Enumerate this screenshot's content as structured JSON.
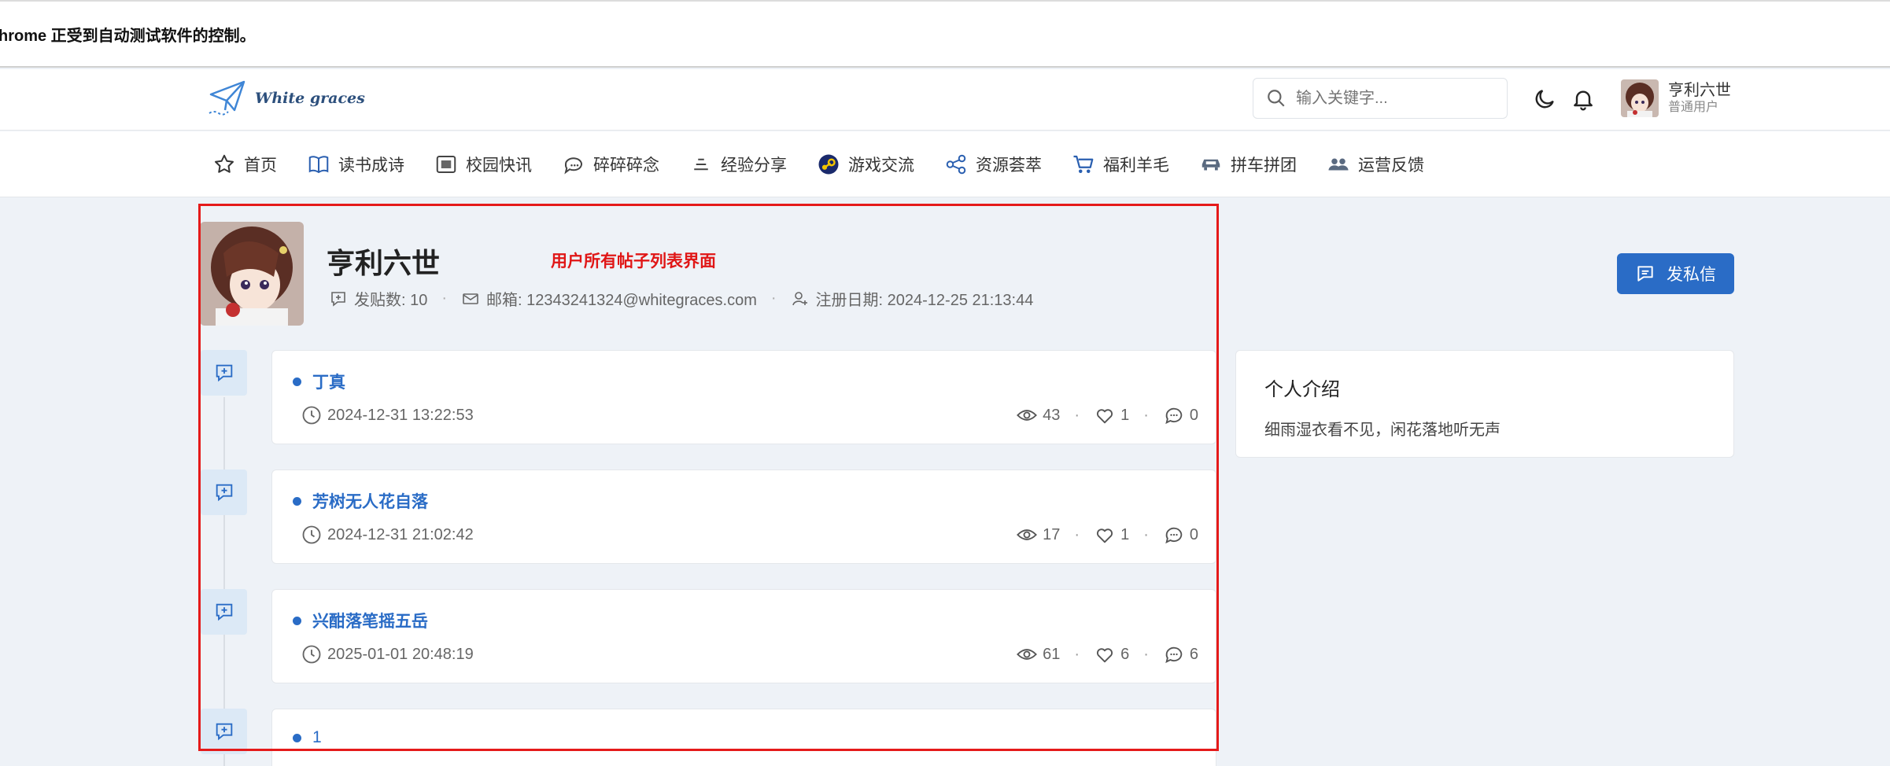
{
  "browser": {
    "infobar_text": "hrome 正受到自动测试软件的控制。"
  },
  "header": {
    "brand": "White graces",
    "search_placeholder": "输入关键字...",
    "icons": [
      "search-icon",
      "moon-icon",
      "bell-icon"
    ],
    "user": {
      "name": "亨利六世",
      "role": "普通用户"
    }
  },
  "nav": {
    "items": [
      {
        "label": "首页",
        "icon": "star-icon"
      },
      {
        "label": "读书成诗",
        "icon": "book-icon"
      },
      {
        "label": "校园快讯",
        "icon": "news-icon"
      },
      {
        "label": "碎碎碎念",
        "icon": "chat-bubble-icon"
      },
      {
        "label": "经验分享",
        "icon": "stack-icon"
      },
      {
        "label": "游戏交流",
        "icon": "steam-icon"
      },
      {
        "label": "资源荟萃",
        "icon": "share-nodes-icon"
      },
      {
        "label": "福利羊毛",
        "icon": "cart-icon"
      },
      {
        "label": "拼车拼团",
        "icon": "car-icon"
      },
      {
        "label": "运营反馈",
        "icon": "users-icon"
      }
    ]
  },
  "profile": {
    "name": "亨利六世",
    "annotation": "用户所有帖子列表界面",
    "post_count": "发贴数: 10",
    "email": "邮箱: 12343241324@whitegraces.com",
    "register_date": "注册日期: 2024-12-25 21:13:44",
    "dm_button": "发私信"
  },
  "posts": [
    {
      "title": "丁真",
      "date": "2024-12-31 13:22:53",
      "views": "43",
      "likes": "1",
      "comments": "0"
    },
    {
      "title": "芳树无人花自落",
      "date": "2024-12-31 21:02:42",
      "views": "17",
      "likes": "1",
      "comments": "0"
    },
    {
      "title": "兴酣落笔摇五岳",
      "date": "2025-01-01 20:48:19",
      "views": "61",
      "likes": "6",
      "comments": "6"
    },
    {
      "title": "1"
    }
  ],
  "intro": {
    "heading": "个人介绍",
    "body": "细雨湿衣看不见，闲花落地听无声"
  },
  "colors": {
    "accent": "#2a6cc6",
    "annotation": "#e01616",
    "background": "#eef2f7"
  }
}
